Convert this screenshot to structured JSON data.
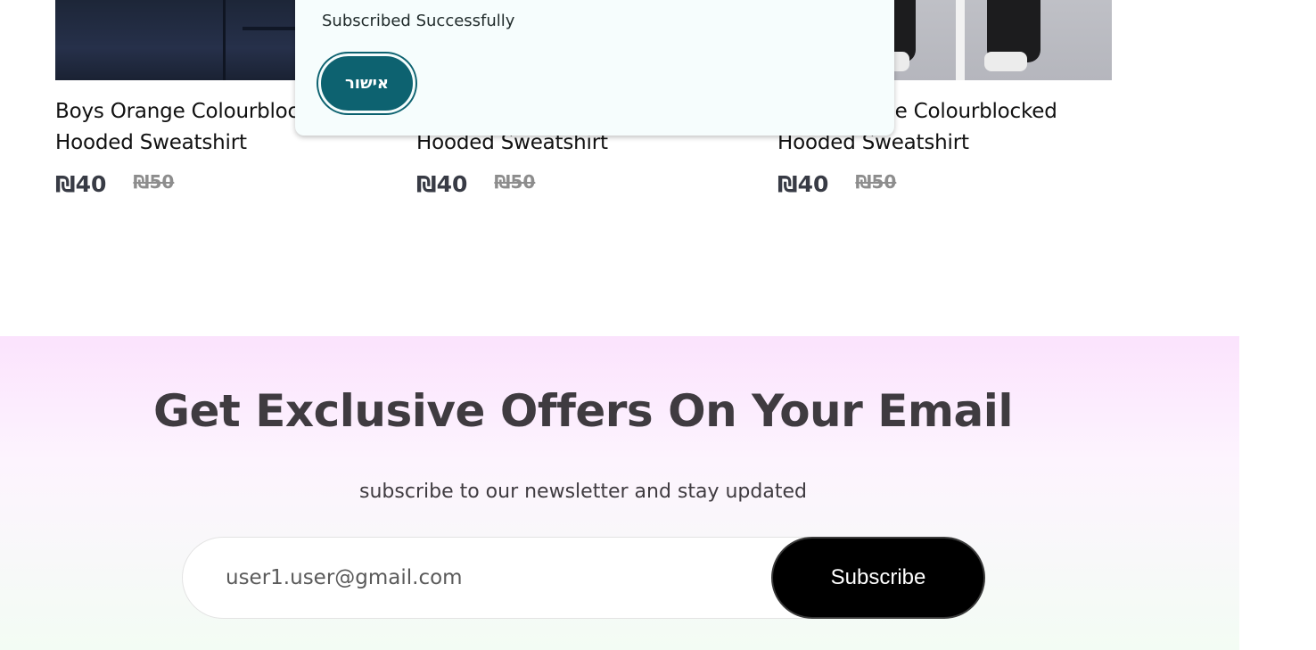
{
  "products": [
    {
      "title": "Boys Orange Colourblocked Hooded Sweatshirt",
      "price": "₪40",
      "old_price": "₪50"
    },
    {
      "title": "Boys Orange Colourblocked Hooded Sweatshirt",
      "price": "₪40",
      "old_price": "₪50"
    },
    {
      "title": "Boys Orange Colourblocked Hooded Sweatshirt",
      "price": "₪40",
      "old_price": "₪50"
    }
  ],
  "modal": {
    "message": "Subscribed Successfully",
    "confirm_label": "אישור",
    "button_color": "#0d6270"
  },
  "newsletter": {
    "title": "Get Exclusive Offers On Your Email",
    "subtitle": "subscribe to our newsletter and stay updated",
    "email_value": "user1.user@gmail.com",
    "subscribe_label": "Subscribe"
  }
}
